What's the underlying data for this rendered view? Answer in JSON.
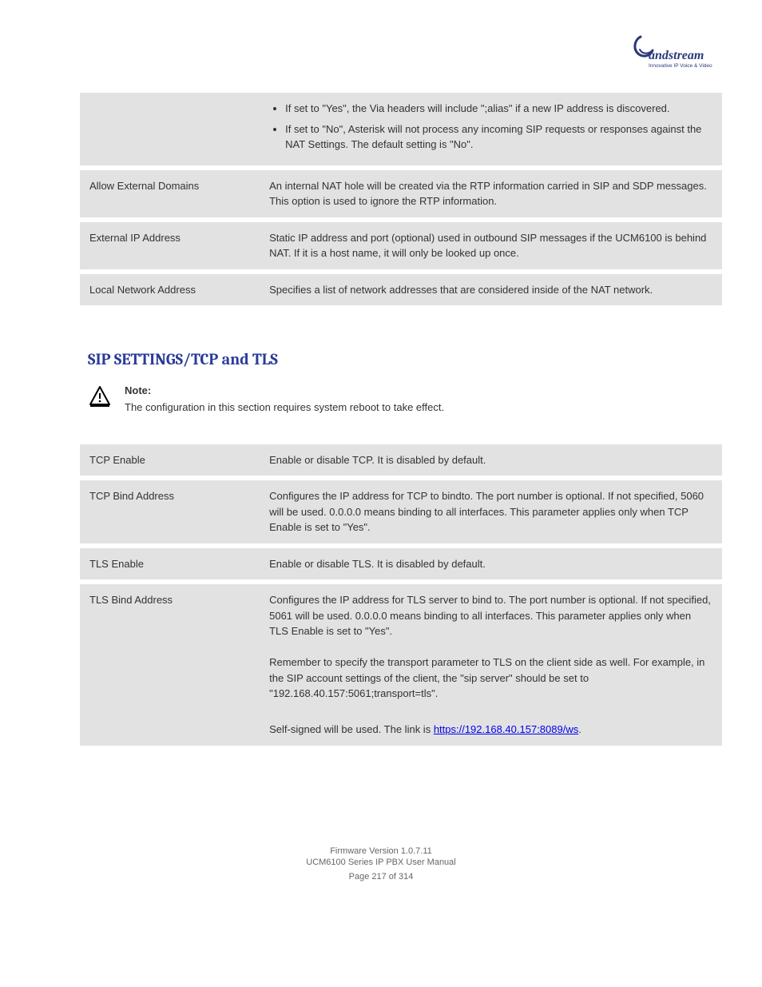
{
  "logo": {
    "brand": "Grandstream",
    "tagline": "Innovative IP Voice & Video"
  },
  "table1": {
    "rows": [
      {
        "label": "",
        "desc_html": "bullets",
        "b1": "If set to \"Yes\", the Via headers will include \";alias\" if a new IP address is discovered.",
        "b2": "If set to \"No\", Asterisk will not process any incoming SIP requests or responses against the NAT Settings. The default setting is \"No\"."
      },
      {
        "label": "Allow External Domains",
        "desc": "An internal NAT hole will be created via the RTP information carried in SIP and SDP messages. This option is used to ignore the RTP information."
      },
      {
        "label": "External IP Address",
        "desc": "Static IP address and port (optional) used in outbound SIP messages if the UCM6100 is behind NAT. If it is a host name, it will only be looked up once."
      },
      {
        "label": "Local Network Address",
        "desc": "Specifies a list of network addresses that are considered inside of the NAT network."
      }
    ]
  },
  "section_title": "SIP SETTINGS/TCP and TLS",
  "note": {
    "title": "Note:",
    "text": "The configuration in this section requires system reboot to take effect."
  },
  "table2": {
    "rows": [
      {
        "label": "TCP Enable",
        "desc": "Enable or disable TCP. It is disabled by default."
      },
      {
        "label": "TCP Bind Address",
        "desc": "Configures the IP address for TCP to bindto. The port number is optional. If not specified, 5060 will be used. 0.0.0.0 means binding to all interfaces. This parameter applies only when TCP Enable is set to \"Yes\"."
      },
      {
        "label": "TLS Enable",
        "desc": "Enable or disable TLS. It is disabled by default."
      },
      {
        "label": "TLS Bind Address",
        "desc_main": "Configures the IP address for TLS server to bind to. The port number is optional. If not specified, 5061 will be used. 0.0.0.0 means binding to all interfaces. This parameter applies only when TLS Enable is set to \"Yes\".",
        "desc_p2": "Remember to specify the transport parameter to TLS on the client side as well. For example, in the SIP account settings of the client, the \"sip server\" should be set to \"192.168.40.157:5061;transport=tls\".",
        "self_signed_prefix": "Self-signed will be used. The link is ",
        "self_signed_link_text": "https://192.168.40.157:8089/ws",
        "self_signed_suffix": "."
      }
    ]
  },
  "footer": {
    "line1": "Firmware Version 1.0.7.11",
    "line2_prefix": "UCM6100 Series IP PBX User Manual",
    "page": "Page 217 of 314"
  }
}
